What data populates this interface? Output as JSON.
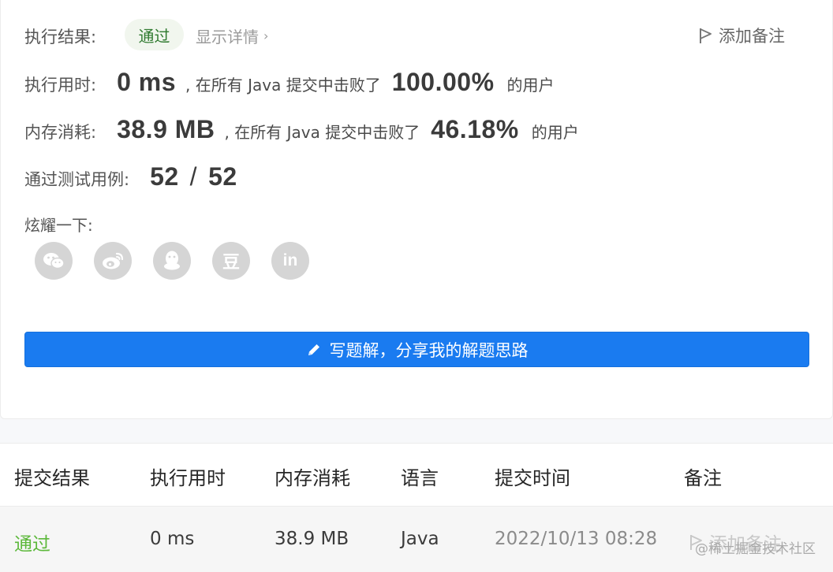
{
  "result": {
    "label": "执行结果:",
    "status": "通过",
    "details_link": "显示详情",
    "add_note": "添加备注"
  },
  "runtime": {
    "label": "执行用时:",
    "value": "0 ms",
    "mid_text": ", 在所有 Java 提交中击败了",
    "percent": "100.00%",
    "suffix": "的用户"
  },
  "memory": {
    "label": "内存消耗:",
    "value": "38.9 MB",
    "mid_text": ", 在所有 Java 提交中击败了",
    "percent": "46.18%",
    "suffix": "的用户"
  },
  "testcases": {
    "label": "通过测试用例:",
    "passed": "52",
    "separator": "/",
    "total": "52"
  },
  "share": {
    "label": "炫耀一下:",
    "icons": [
      "wechat-icon",
      "weibo-icon",
      "qq-icon",
      "douban-icon",
      "linkedin-icon"
    ],
    "douban_glyph": "豆",
    "linkedin_glyph": "in"
  },
  "write_button": {
    "label": "写题解，分享我的解题思路"
  },
  "table": {
    "headers": [
      "提交结果",
      "执行用时",
      "内存消耗",
      "语言",
      "提交时间",
      "备注"
    ],
    "rows": [
      {
        "result": "通过",
        "runtime": "0 ms",
        "memory": "38.9 MB",
        "language": "Java",
        "time": "2022/10/13 08:28",
        "note": "添加备注"
      }
    ]
  },
  "watermark": "@稀土掘金技术社区",
  "colors": {
    "accent": "#1a7bf0",
    "success": "#5cb83a",
    "badge_bg": "#f1f6ee"
  }
}
